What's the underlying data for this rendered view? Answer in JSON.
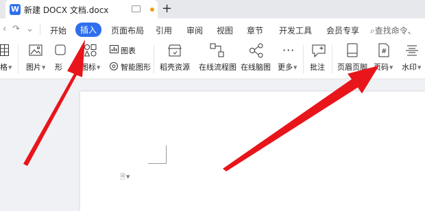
{
  "tab": {
    "title": "新建 DOCX 文档.docx",
    "logo": "W"
  },
  "toolbar": {
    "undo": "↶",
    "redo": "↷"
  },
  "menu": {
    "items": [
      "开始",
      "插入",
      "页面布局",
      "引用",
      "审阅",
      "视图",
      "章节",
      "开发工具",
      "会员专享"
    ],
    "active": "插入",
    "search": "查找命令、"
  },
  "ribbon": {
    "table_label": "格",
    "picture_label": "图片",
    "shape_label": "形",
    "icon_label": "图标",
    "chart_label": "图表",
    "smartart_label": "智能图形",
    "resource_label": "稻壳资源",
    "flowchart_label": "在线流程图",
    "mindmap_label": "在线脑图",
    "more_label": "更多",
    "comment_label": "批注",
    "header_footer_label": "页眉页脚",
    "page_number_label": "页码",
    "page_number_icon": "#",
    "watermark_label": "水印"
  },
  "colors": {
    "accent": "#2f6fed",
    "arrow": "#e8151b"
  }
}
